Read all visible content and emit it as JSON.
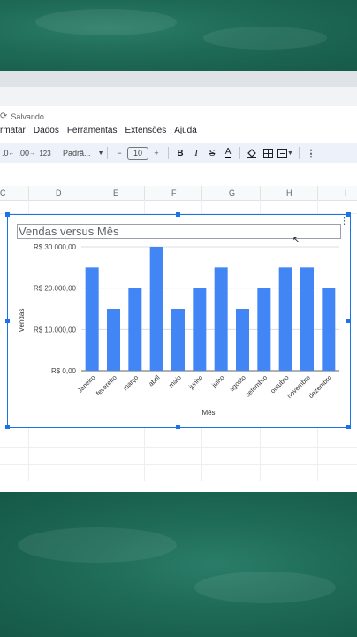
{
  "app": {
    "status": "Salvando...",
    "status_icon": "sync-icon"
  },
  "menu": [
    "rmatar",
    "Dados",
    "Ferramentas",
    "Extensões",
    "Ajuda"
  ],
  "toolbar": {
    "decrease_decimal": ".0",
    "increase_decimal": ".00",
    "number_format": "123",
    "font": "Padrã...",
    "minus": "−",
    "font_size": "10",
    "plus": "+",
    "bold": "B",
    "italic": "I",
    "strike": "S",
    "text_color": "A"
  },
  "columns": [
    "C",
    "D",
    "E",
    "F",
    "G",
    "H",
    "I"
  ],
  "chart_data": {
    "type": "bar",
    "title": "Vendas versus Mês",
    "xlabel": "Mês",
    "ylabel": "Vendas",
    "categories": [
      "Janeiro",
      "fevereiro",
      "março",
      "abril",
      "maio",
      "junho",
      "julho",
      "agosto",
      "setembro",
      "outubro",
      "novembro",
      "dezembro"
    ],
    "values": [
      25000,
      15000,
      20000,
      30000,
      15000,
      20000,
      25000,
      15000,
      20000,
      25000,
      25000,
      20000
    ],
    "ylim": [
      0,
      30000
    ],
    "yticks": [
      0,
      10000,
      20000,
      30000
    ],
    "ytick_labels": [
      "R$ 0,00",
      "R$ 10.000,00",
      "R$ 20.000,00",
      "R$ 30.000,00"
    ],
    "grid": true,
    "bar_color": "#4285f4"
  }
}
